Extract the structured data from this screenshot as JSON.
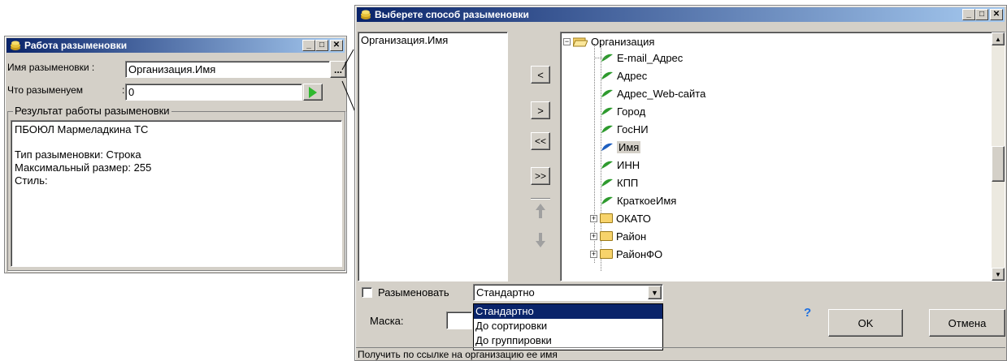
{
  "left_window": {
    "title": "Работа разыменовки",
    "name_label": "Имя разыменовки :",
    "name_value": "Организация.Имя",
    "browse_label": "...",
    "what_label": "Что разыменуем",
    "what_colon": ":",
    "what_value": "0",
    "result_group_label": "Результат работы разыменовки",
    "result_lines": [
      "ПБОЮЛ Мармеладкина ТС",
      "",
      "Тип разыменовки: Строка",
      "Максимальный размер: 255",
      "Стиль:"
    ]
  },
  "right_window": {
    "title": "Выберете способ разыменовки",
    "selected_path": "Организация.Имя",
    "move_buttons": [
      "<",
      ">",
      "<<",
      ">>"
    ],
    "tree": {
      "root": "Организация",
      "leaves": [
        "E-mail_Адрес",
        "Адрес",
        "Адрес_Web-сайта",
        "Город",
        "ГосНИ",
        "Имя",
        "ИНН",
        "КПП",
        "КраткоеИмя"
      ],
      "folders": [
        "ОКАТО",
        "Район",
        "РайонФО"
      ]
    },
    "dereference_checkbox_label": "Разыменовать",
    "mode_selected": "Стандартно",
    "mode_options": [
      "Стандартно",
      "До сортировки",
      "До группировки"
    ],
    "mask_label": "Маска:",
    "help_label": "?",
    "ok_label": "OK",
    "cancel_label": "Отмена",
    "status_text": "Получить по ссылке на организацию ее имя"
  },
  "colors": {
    "title_active": "#0a246a",
    "title_gradient_end": "#a6caf0",
    "face": "#d4d0c8",
    "leaf_green": "#2e9a2e",
    "help_blue": "#1e6fe0"
  }
}
